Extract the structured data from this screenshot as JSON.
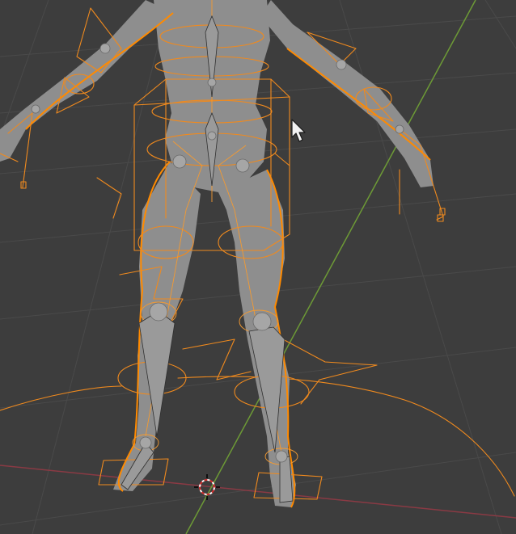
{
  "viewport": {
    "background": "#3d3d3d",
    "grid_color": "#4a4a4a",
    "x_axis_color": "#8a3a44",
    "y_axis_color": "#6d9a36",
    "selection_color": "#f08a1e",
    "mesh_color": "#8e8e8e"
  },
  "objects": {
    "mesh": "character-body-mesh",
    "armature": "character-armature"
  },
  "icons": {
    "cursor": "mouse-pointer-icon",
    "origin": "3d-cursor-icon"
  }
}
